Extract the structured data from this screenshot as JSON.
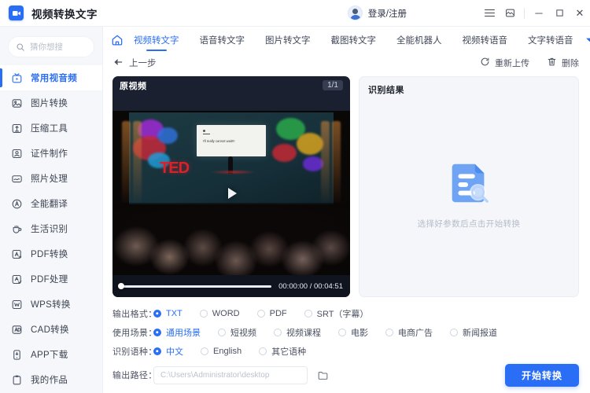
{
  "titlebar": {
    "app_title": "视频转换文字",
    "logo_icon": "video-camera-icon",
    "account_label": "登录/注册",
    "avatar_icon": "user-avatar-icon",
    "menu_icon": "hamburger-menu-icon",
    "screenshot_icon": "screenshot-icon",
    "minimize_icon": "minimize-icon",
    "maximize_icon": "maximize-icon",
    "close_icon": "close-icon",
    "minimize_glyph": "─",
    "maximize_glyph": "☐",
    "close_glyph": "✕"
  },
  "sidebar": {
    "search": {
      "placeholder": "猜你想搜",
      "value": "",
      "icon": "search-icon"
    },
    "items": [
      {
        "label": "常用视音频",
        "icon": "tv-play-icon",
        "active": true
      },
      {
        "label": "图片转换",
        "icon": "image-icon",
        "active": false
      },
      {
        "label": "压缩工具",
        "icon": "compress-icon",
        "active": false
      },
      {
        "label": "证件制作",
        "icon": "id-card-icon",
        "active": false
      },
      {
        "label": "照片处理",
        "icon": "photo-edit-icon",
        "active": false
      },
      {
        "label": "全能翻译",
        "icon": "translate-icon",
        "active": false
      },
      {
        "label": "生活识别",
        "icon": "cup-icon",
        "active": false
      },
      {
        "label": "PDF转换",
        "icon": "pdf-convert-icon",
        "active": false
      },
      {
        "label": "PDF处理",
        "icon": "pdf-check-icon",
        "active": false
      },
      {
        "label": "WPS转换",
        "icon": "wps-icon",
        "active": false
      },
      {
        "label": "CAD转换",
        "icon": "cad-icon",
        "active": false
      },
      {
        "label": "APP下载",
        "icon": "app-download-icon",
        "active": false
      },
      {
        "label": "我的作品",
        "icon": "my-works-icon",
        "active": false
      }
    ]
  },
  "main": {
    "home_icon": "home-icon",
    "more_tabs_icon": "chevron-down-icon",
    "tabs": [
      {
        "label": "视频转文字",
        "active": true
      },
      {
        "label": "语音转文字",
        "active": false
      },
      {
        "label": "图片转文字",
        "active": false
      },
      {
        "label": "截图转文字",
        "active": false
      },
      {
        "label": "全能机器人",
        "active": false
      },
      {
        "label": "视频转语音",
        "active": false
      },
      {
        "label": "文字转语音",
        "active": false
      }
    ],
    "actions": {
      "back_label": "上一步",
      "back_icon": "arrow-left-icon",
      "reupload_label": "重新上传",
      "reupload_icon": "refresh-icon",
      "delete_label": "删除",
      "delete_icon": "trash-icon"
    },
    "video_panel": {
      "title": "原视频",
      "counter": "1/1",
      "play_icon": "play-icon",
      "current_time": "00:00:00",
      "total_time": "00:04:51",
      "time_display": "00:00:00 / 00:04:51",
      "progress_percent": 0,
      "frame_brand_text": "TED",
      "frame_slide_text": "I'll really cannot wait!!!"
    },
    "result_panel": {
      "title": "识别结果",
      "empty_icon": "document-search-icon",
      "empty_hint": "选择好参数后点击开始转换"
    },
    "form": {
      "output_format": {
        "label": "输出格式：",
        "options": [
          {
            "label": "TXT",
            "selected": true
          },
          {
            "label": "WORD",
            "selected": false
          },
          {
            "label": "PDF",
            "selected": false
          },
          {
            "label": "SRT（字幕）",
            "selected": false
          }
        ]
      },
      "use_scene": {
        "label": "使用场景：",
        "options": [
          {
            "label": "通用场景",
            "selected": true
          },
          {
            "label": "短视频",
            "selected": false
          },
          {
            "label": "视频课程",
            "selected": false
          },
          {
            "label": "电影",
            "selected": false
          },
          {
            "label": "电商广告",
            "selected": false
          },
          {
            "label": "新闻报道",
            "selected": false
          }
        ]
      },
      "language": {
        "label": "识别语种：",
        "options": [
          {
            "label": "中文",
            "selected": true
          },
          {
            "label": "English",
            "selected": false
          },
          {
            "label": "其它语种",
            "selected": false
          }
        ]
      },
      "output_path": {
        "label": "输出路径：",
        "value": "",
        "placeholder": "C:\\Users\\Administrator\\desktop",
        "browse_icon": "folder-icon"
      },
      "submit_label": "开始转换"
    }
  },
  "colors": {
    "accent": "#2b6ef6",
    "sidebar_bg": "#f5f7fb",
    "video_bg": "#1b2030",
    "result_bg": "#f4f6fa",
    "text": "#3d4451"
  }
}
